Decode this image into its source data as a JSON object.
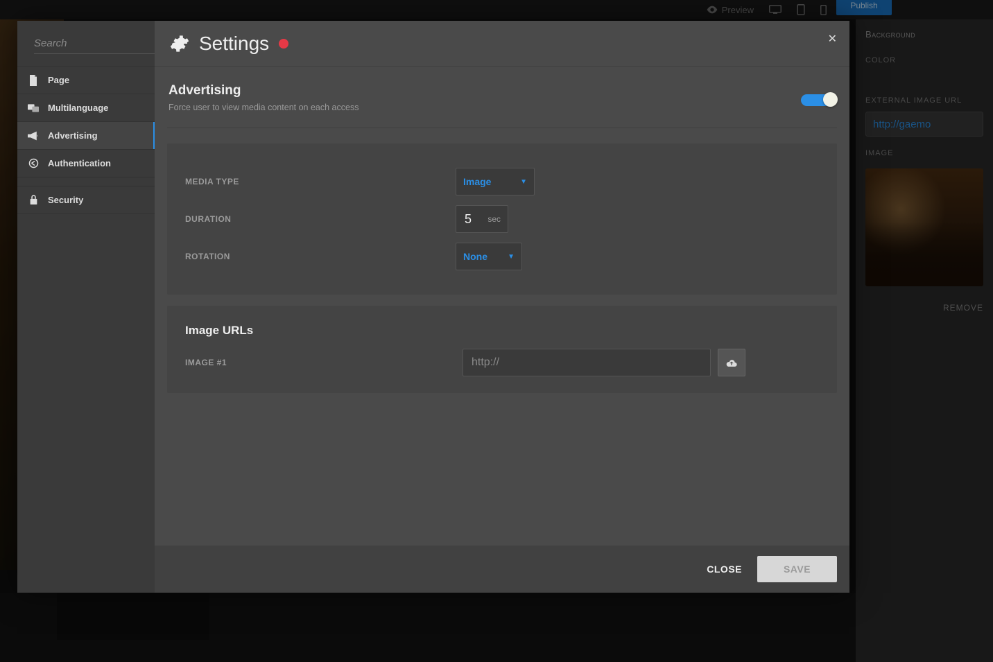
{
  "topbar": {
    "preview": "Preview",
    "publish": "Publish"
  },
  "inspector": {
    "section": "Background",
    "color_label": "COLOR",
    "ext_url_label": "EXTERNAL IMAGE URL",
    "ext_url_value": "http://gaemo",
    "image_label": "IMAGE",
    "remove": "REMOVE"
  },
  "sidebar": {
    "search_placeholder": "Search",
    "items": [
      {
        "label": "Page",
        "icon": "page"
      },
      {
        "label": "Multilanguage",
        "icon": "lang"
      },
      {
        "label": "Advertising",
        "icon": "megaphone",
        "selected": true
      },
      {
        "label": "Authentication",
        "icon": "auth"
      },
      {
        "label": "Security",
        "icon": "lock"
      }
    ]
  },
  "header": {
    "title": "Settings",
    "unsaved_indicator": true
  },
  "section": {
    "title": "Advertising",
    "desc": "Force user to view media content on each access",
    "toggle_on": true
  },
  "form": {
    "media_type_label": "MEDIA TYPE",
    "media_type_value": "Image",
    "duration_label": "DURATION",
    "duration_value": "5",
    "duration_suffix": "sec",
    "rotation_label": "ROTATION",
    "rotation_value": "None"
  },
  "urls": {
    "title": "Image URLs",
    "image1_label": "IMAGE #1",
    "image1_placeholder": "http://",
    "image1_value": ""
  },
  "footer": {
    "close": "CLOSE",
    "save": "SAVE"
  }
}
